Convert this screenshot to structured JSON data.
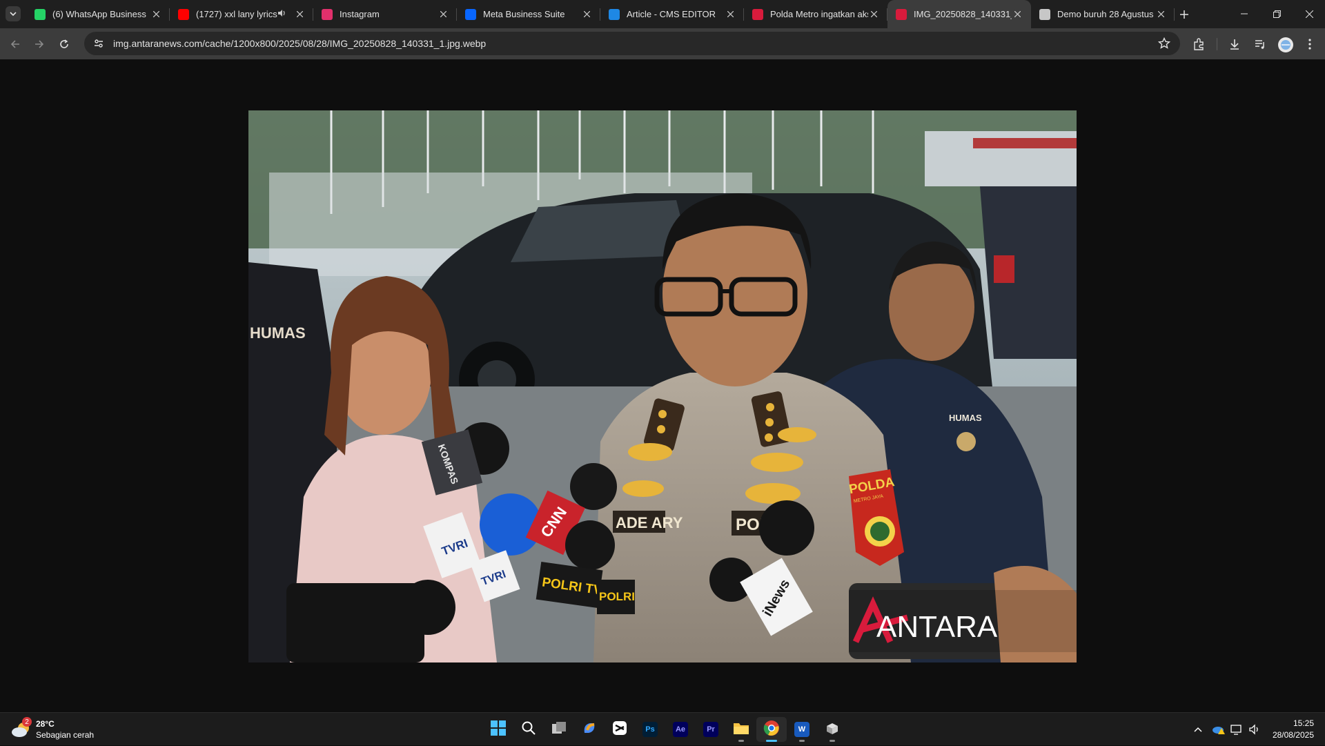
{
  "browser": {
    "tabs": [
      {
        "title": "(6) WhatsApp Business",
        "favicon": "whatsapp-icon",
        "color": "#25d366"
      },
      {
        "title": "(1727) xxl lany lyrics -",
        "favicon": "youtube-icon",
        "color": "#ff0000",
        "audio": true
      },
      {
        "title": "Instagram",
        "favicon": "instagram-icon",
        "color": "#e1306c"
      },
      {
        "title": "Meta Business Suite",
        "favicon": "meta-icon",
        "color": "#0866ff"
      },
      {
        "title": "Article - CMS EDITOR",
        "favicon": "cms-icon",
        "color": "#1e88e5"
      },
      {
        "title": "Polda Metro ingatkan aks",
        "favicon": "antara-icon",
        "color": "#d81b3c"
      },
      {
        "title": "IMG_20250828_140331_1",
        "favicon": "antara-icon",
        "color": "#d81b3c",
        "active": true
      },
      {
        "title": "Demo buruh 28 Agustus",
        "favicon": "globe-icon",
        "color": "#c7c7c7"
      }
    ],
    "url": "img.antaranews.com/cache/1200x800/2025/08/28/IMG_20250828_140331_1.jpg.webp"
  },
  "photo": {
    "badge_left": "HUMAS",
    "badge_right": "HUMAS",
    "nametag": "ADE ARY",
    "chest_label": "POLRI",
    "patch_top": "POLDA",
    "patch_sub": "METRO JAYA",
    "mic_labels": [
      "KOMPAS",
      "TVRI",
      "TVRI",
      "CNN",
      "POLRI TV",
      "POLRI",
      "iNews"
    ],
    "watermark": "ANTARA"
  },
  "taskbar": {
    "weather_temp": "28°C",
    "weather_desc": "Sebagian cerah",
    "weather_badge": "2",
    "apps": [
      {
        "name": "start",
        "label": ""
      },
      {
        "name": "search",
        "label": ""
      },
      {
        "name": "task-view",
        "label": ""
      },
      {
        "name": "copilot",
        "label": ""
      },
      {
        "name": "capcut",
        "label": ""
      },
      {
        "name": "photoshop",
        "label": "Ps"
      },
      {
        "name": "after-effects",
        "label": "Ae"
      },
      {
        "name": "premiere",
        "label": "Pr"
      },
      {
        "name": "file-explorer",
        "label": ""
      },
      {
        "name": "chrome",
        "label": ""
      },
      {
        "name": "word",
        "label": "W"
      },
      {
        "name": "app-installer",
        "label": ""
      }
    ],
    "time": "15:25",
    "date": "28/08/2025"
  }
}
